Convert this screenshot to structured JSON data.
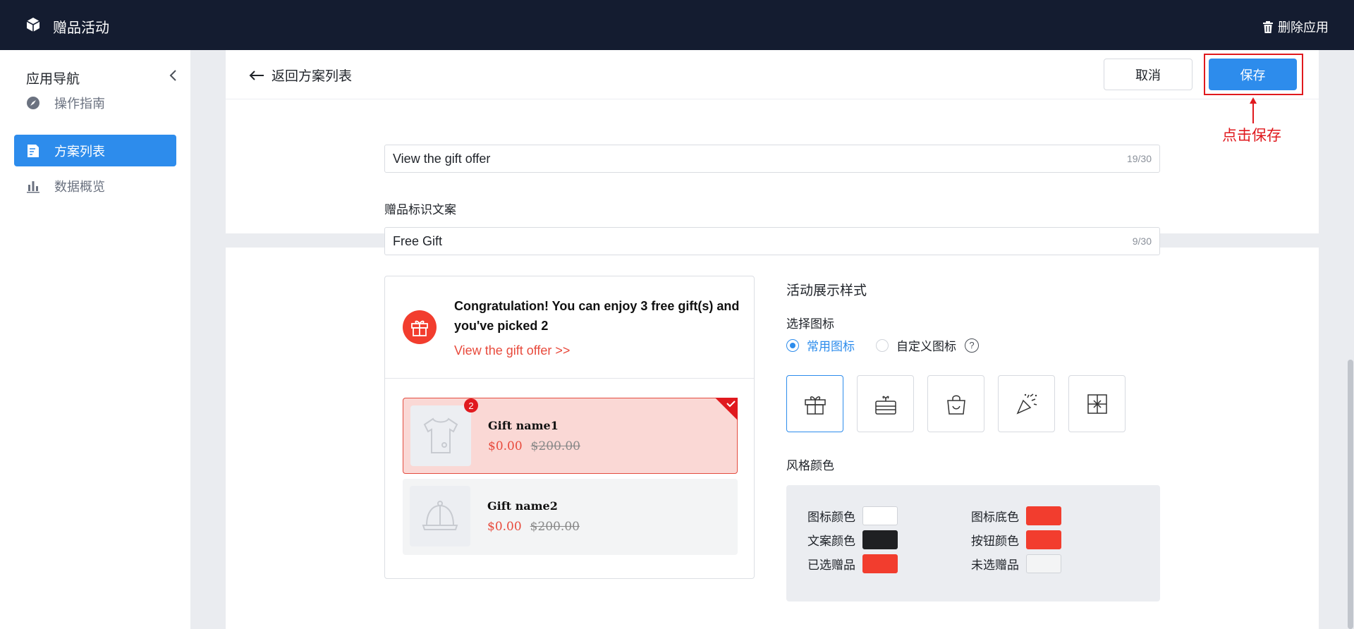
{
  "topbar": {
    "app_title": "赠品活动",
    "delete_label": "删除应用"
  },
  "sidebar": {
    "title": "应用导航",
    "items": [
      {
        "label": "操作指南",
        "icon": "compass-icon",
        "active": false
      },
      {
        "label": "方案列表",
        "icon": "list-doc-icon",
        "active": true
      },
      {
        "label": "数据概览",
        "icon": "bar-chart-icon",
        "active": false
      }
    ]
  },
  "header": {
    "back_label": "返回方案列表",
    "cancel_label": "取消",
    "save_label": "保存"
  },
  "annotation": {
    "hint": "点击保存",
    "color": "#e0191e"
  },
  "form": {
    "offer_text": {
      "value": "View the gift offer",
      "count": "19/30"
    },
    "gift_label_title": "赠品标识文案",
    "gift_label": {
      "value": "Free Gift",
      "count": "9/30"
    }
  },
  "preview": {
    "message": "Congratulation! You can enjoy 3 free gift(s) and you've picked 2",
    "link": "View the gift offer >>",
    "gifts": [
      {
        "name": "Gift name1",
        "price": "$0.00",
        "original_price": "$200.00",
        "badge": "2",
        "selected": true
      },
      {
        "name": "Gift name2",
        "price": "$0.00",
        "original_price": "$200.00",
        "selected": false
      }
    ]
  },
  "style": {
    "section_title": "活动展示样式",
    "icon_title": "选择图标",
    "radio_common": "常用图标",
    "radio_custom": "自定义图标",
    "help": "?",
    "icons": [
      "gift-box-icon",
      "cake-icon",
      "shopping-bag-icon",
      "party-popper-icon",
      "gift-card-icon"
    ],
    "color_title": "风格颜色",
    "colors": [
      {
        "label": "图标颜色",
        "value": "#ffffff"
      },
      {
        "label": "图标底色",
        "value": "#f23d2e"
      },
      {
        "label": "文案颜色",
        "value": "#1f2023"
      },
      {
        "label": "按钮颜色",
        "value": "#f23d2e"
      },
      {
        "label": "已选赠品",
        "value": "#f23d2e"
      },
      {
        "label": "未选赠品",
        "value": "#f3f4f5"
      }
    ]
  },
  "theme": {
    "accent": "#2d8cec",
    "topbar": "#141c30",
    "brand_red": "#f23d2e"
  }
}
